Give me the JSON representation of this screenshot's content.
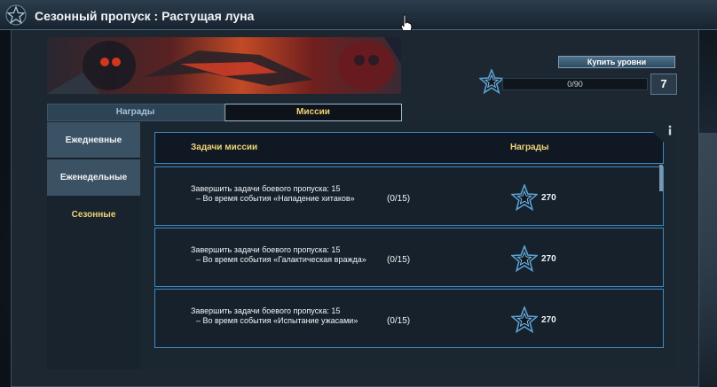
{
  "window": {
    "title": "Сезонный пропуск : Растущая луна"
  },
  "battle_pass": {
    "buy_levels_label": "Купить уровни",
    "progress_text": "0/90",
    "progress_fraction": 0.0,
    "level": "7"
  },
  "tabs": [
    {
      "label": "Награды",
      "active": false
    },
    {
      "label": "Миссии",
      "active": true
    }
  ],
  "sidebar": [
    {
      "label": "Ежедневные"
    },
    {
      "label": "Еженедельные"
    },
    {
      "label": "Сезонные"
    }
  ],
  "missions": {
    "header_tasks": "Задачи миссии",
    "header_rewards": "Награды",
    "rows": [
      {
        "title": "Завершить задачи боевого пропуска: 15",
        "detail": "– Во время события «Нападение хитаков»",
        "progress": "(0/15)",
        "reward": "270"
      },
      {
        "title": "Завершить задачи боевого пропуска: 15",
        "detail": "– Во время события «Галактическая вражда»",
        "progress": "(0/15)",
        "reward": "270"
      },
      {
        "title": "Завершить задачи боевого пропуска: 15",
        "detail": "– Во время события «Испытание ужасами»",
        "progress": "(0/15)",
        "reward": "270"
      }
    ]
  },
  "colors": {
    "accent_gold": "#f0d276",
    "frame_blue": "#3e89c2",
    "star_blue": "#5ba3d6"
  }
}
